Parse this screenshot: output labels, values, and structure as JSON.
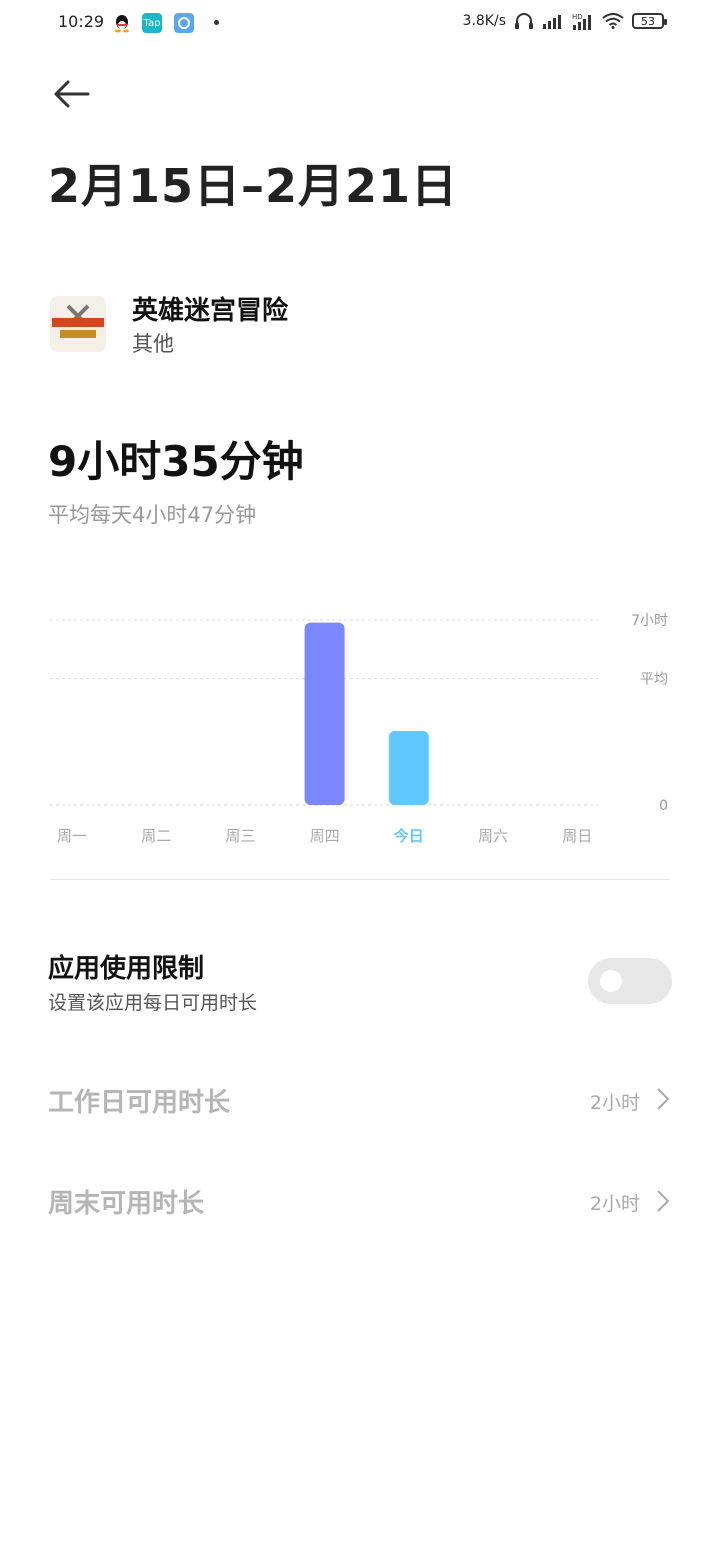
{
  "status_bar": {
    "time": "10:29",
    "net_speed": "3.8K/s",
    "battery": "53",
    "notification_icons": [
      "qq-icon",
      "taptap-icon",
      "app-icon"
    ]
  },
  "header": {
    "date_range": "2月15日–2月21日"
  },
  "app": {
    "name": "英雄迷宫冒险",
    "category": "其他"
  },
  "usage": {
    "total": "9小时35分钟",
    "average": "平均每天4小时47分钟"
  },
  "chart_data": {
    "type": "bar",
    "categories": [
      "周一",
      "周二",
      "周三",
      "周四",
      "今日",
      "周六",
      "周日"
    ],
    "values_hours": [
      0,
      0,
      0,
      6.9,
      2.8,
      0,
      0
    ],
    "bar_colors": [
      "#7b87ff",
      "#7b87ff",
      "#7b87ff",
      "#7b87ff",
      "#5ec8ff",
      "#7b87ff",
      "#7b87ff"
    ],
    "highlight_category": "今日",
    "highlight_color": "#5ec8ff",
    "ytick_labels": {
      "max": "7小时",
      "avg": "平均",
      "zero": "0"
    },
    "ylim_hours": [
      0,
      7
    ],
    "avg_line_hours": 4.78,
    "grid": "dashed-horizontal"
  },
  "limits": {
    "title": "应用使用限制",
    "subtitle": "设置该应用每日可用时长",
    "enabled": false,
    "workday_label": "工作日可用时长",
    "workday_value": "2小时",
    "weekend_label": "周末可用时长",
    "weekend_value": "2小时"
  }
}
